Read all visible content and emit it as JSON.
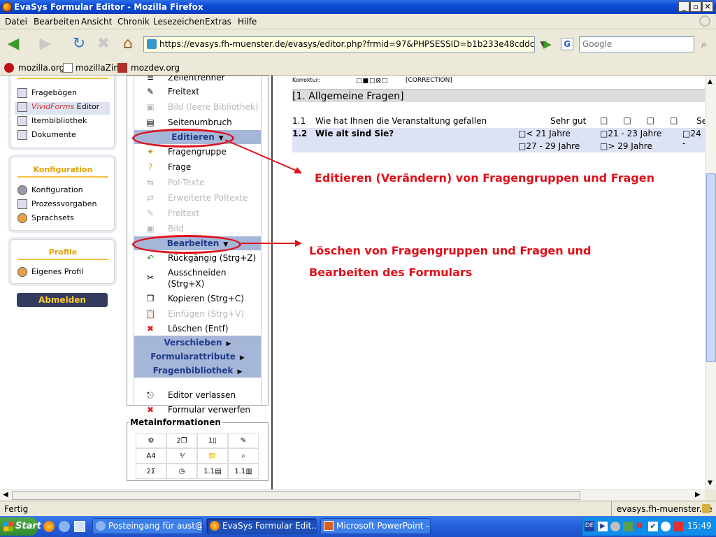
{
  "window": {
    "title": "EvaSys Formular Editor - Mozilla Firefox",
    "btn_min": "_",
    "btn_max": "▫",
    "btn_close": "✕"
  },
  "menubar": [
    "Datei",
    "Bearbeiten",
    "Ansicht",
    "Chronik",
    "Lesezeichen",
    "Extras",
    "Hilfe"
  ],
  "nav": {
    "url": "https://evasys.fh-muenster.de/evasys/editor.php?frmid=97&PHPSESSID=b1b233e48cddc64bc3cd2da",
    "search_placeholder": "Google",
    "search_engine": "G"
  },
  "bookmarks": [
    "mozilla.org",
    "mozillaZine",
    "mozdev.org"
  ],
  "sidebar": {
    "nav_items": [
      {
        "label": "Fragebögen"
      },
      {
        "label_accent": "VividForms",
        "label": " Editor"
      },
      {
        "label": "Itembibliothek"
      },
      {
        "label": "Dokumente"
      }
    ],
    "konfig_title": "Konfiguration",
    "konfig_items": [
      "Konfiguration",
      "Prozessvorgaben",
      "Sprachsets"
    ],
    "profile_title": "Profile",
    "profile_items": [
      "Eigenes Profil"
    ],
    "logout": "Abmelden"
  },
  "editor_menu": {
    "top_partial": "Zeilentrenner",
    "einfuegen_items": [
      "Freitext",
      "Bild (leere Bibliothek)",
      "Seitenumbruch"
    ],
    "editieren": "Editieren",
    "editieren_items": [
      "Fragengruppe",
      "Frage",
      "Pol-Texte",
      "Erweiterte Poltexte",
      "Freitext",
      "Bild"
    ],
    "bearbeiten": "Bearbeiten",
    "bearbeiten_items": [
      "Rückgängig (Strg+Z)",
      "Ausschneiden",
      "(Strg+X)",
      "Kopieren (Strg+C)",
      "Einfügen (Strg+V)",
      "Löschen (Entf)"
    ],
    "verschieben": "Verschieben",
    "formularattribute": "Formularattribute",
    "fragenbibliothek": "Fragenbibliothek",
    "bottom_items": [
      "Editor verlassen",
      "Formular verwerfen"
    ]
  },
  "meta": {
    "title": "Metainformationen",
    "cells": [
      "",
      "2",
      "1",
      "",
      "A4",
      "",
      "",
      "",
      "2",
      "",
      "1.1",
      "1.1"
    ]
  },
  "form": {
    "korrektur_label": "Korrektur:",
    "correction": "[CORRECTION]",
    "section": "[1. Allgemeine Fragen]",
    "q1_num": "1.1",
    "q1_text": "Wie hat Ihnen die Veranstaltung gefallen",
    "q1_scale": "Sehr gut",
    "q1_scale_end": "Se",
    "q2_num": "1.2",
    "q2_text": "Wie alt sind Sie?",
    "q2_options": [
      "< 21 Jahre",
      "21 - 23 Jahre",
      "24 -",
      "27 - 29 Jahre",
      "> 29 Jahre"
    ]
  },
  "annotations": {
    "edit": "Editieren (Verändern) von Fragengruppen und Fragen",
    "delete_1": "Löschen von Fragengruppen und Fragen und",
    "delete_2": "Bearbeiten des Formulars"
  },
  "status": {
    "left": "Fertig",
    "right": "evasys.fh-muenster.de"
  },
  "taskbar": {
    "start": "Start",
    "tasks": [
      "Posteingang für aust@fh...",
      "EvaSys Formular Edit...",
      "Microsoft PowerPoint - [..."
    ],
    "lang": "DE",
    "clock": "15:49"
  },
  "colors": {
    "accent_red": "#e0101a",
    "menu_header": "#a6b6d9",
    "side_heading": "#e5a200"
  }
}
